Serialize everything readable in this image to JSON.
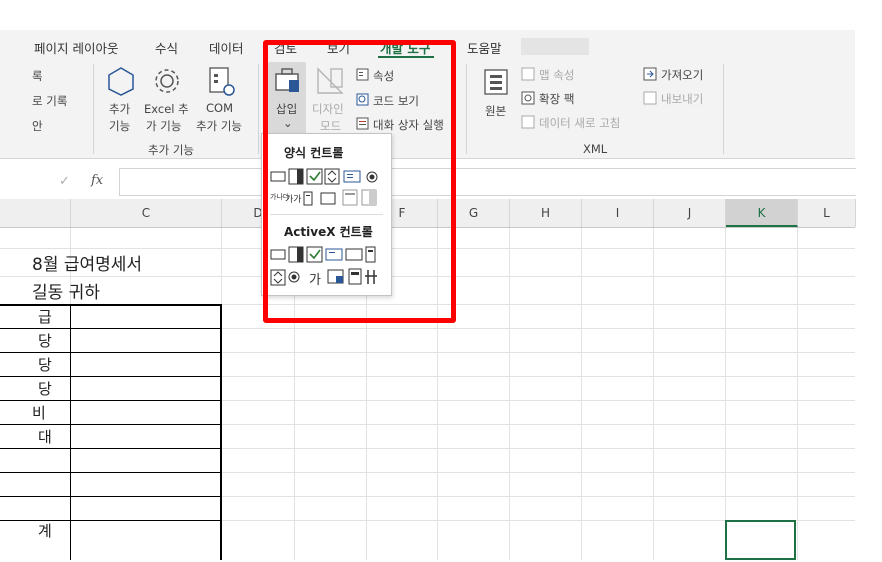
{
  "tabs": [
    "페이지 레이아웃",
    "수식",
    "데이터",
    "검토",
    "보기",
    "개발 도구",
    "도움말"
  ],
  "active_tab": "개발 도구",
  "ribbon": {
    "code_items": [
      "록",
      "로 기록",
      "안"
    ],
    "addins": {
      "addin_label1": "추가",
      "addin_label2": "기능",
      "excel_label1": "Excel 추",
      "excel_label2": "가 기능",
      "com_label1": "COM",
      "com_label2": "추가 기능",
      "group": "추가 기능"
    },
    "controls": {
      "insert_label": "삽입",
      "design_label1": "디자인",
      "design_label2": "모드",
      "properties": "속성",
      "view_code": "코드 보기",
      "run_dialog": "대화 상자 실행"
    },
    "xml": {
      "source_label": "원본",
      "map_props": "맵 속성",
      "expansion_packs": "확장 팩",
      "refresh_data": "데이터 새로 고침",
      "import": "가져오기",
      "export": "내보내기",
      "group": "XML"
    }
  },
  "formula_bar": {
    "fx": "fx",
    "check": "✓"
  },
  "columns": [
    "C",
    "D",
    "E",
    "F",
    "G",
    "H",
    "I",
    "J",
    "K",
    "L"
  ],
  "selected_column": "K",
  "cells": {
    "title": "8월 급여명세서",
    "recipient": "길동 귀하",
    "rows": [
      "급",
      "당",
      "당",
      "당",
      "비",
      "대",
      "",
      "",
      "",
      "계"
    ]
  },
  "dropdown": {
    "form_controls_title": "양식 컨트롤",
    "activex_controls_title": "ActiveX 컨트롤",
    "form_labels": {
      "abc": "가나다",
      "label": "가가"
    },
    "activex_label": "가"
  },
  "colors": {
    "accent": "#1e7145",
    "highlight": "#ff0000"
  }
}
